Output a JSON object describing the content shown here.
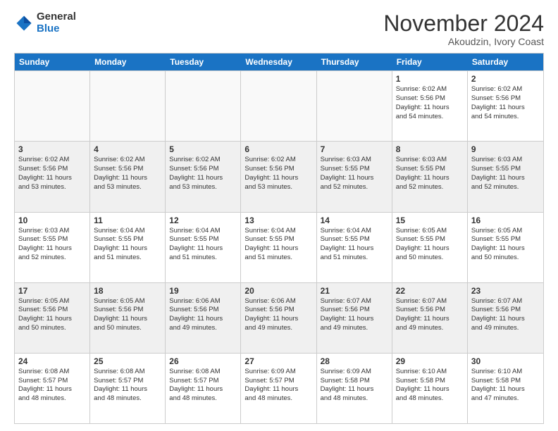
{
  "logo": {
    "general": "General",
    "blue": "Blue"
  },
  "title": "November 2024",
  "location": "Akoudzin, Ivory Coast",
  "header_days": [
    "Sunday",
    "Monday",
    "Tuesday",
    "Wednesday",
    "Thursday",
    "Friday",
    "Saturday"
  ],
  "rows": [
    [
      {
        "day": "",
        "info": "",
        "empty": true
      },
      {
        "day": "",
        "info": "",
        "empty": true
      },
      {
        "day": "",
        "info": "",
        "empty": true
      },
      {
        "day": "",
        "info": "",
        "empty": true
      },
      {
        "day": "",
        "info": "",
        "empty": true
      },
      {
        "day": "1",
        "info": "Sunrise: 6:02 AM\nSunset: 5:56 PM\nDaylight: 11 hours\nand 54 minutes."
      },
      {
        "day": "2",
        "info": "Sunrise: 6:02 AM\nSunset: 5:56 PM\nDaylight: 11 hours\nand 54 minutes."
      }
    ],
    [
      {
        "day": "3",
        "info": "Sunrise: 6:02 AM\nSunset: 5:56 PM\nDaylight: 11 hours\nand 53 minutes."
      },
      {
        "day": "4",
        "info": "Sunrise: 6:02 AM\nSunset: 5:56 PM\nDaylight: 11 hours\nand 53 minutes."
      },
      {
        "day": "5",
        "info": "Sunrise: 6:02 AM\nSunset: 5:56 PM\nDaylight: 11 hours\nand 53 minutes."
      },
      {
        "day": "6",
        "info": "Sunrise: 6:02 AM\nSunset: 5:56 PM\nDaylight: 11 hours\nand 53 minutes."
      },
      {
        "day": "7",
        "info": "Sunrise: 6:03 AM\nSunset: 5:55 PM\nDaylight: 11 hours\nand 52 minutes."
      },
      {
        "day": "8",
        "info": "Sunrise: 6:03 AM\nSunset: 5:55 PM\nDaylight: 11 hours\nand 52 minutes."
      },
      {
        "day": "9",
        "info": "Sunrise: 6:03 AM\nSunset: 5:55 PM\nDaylight: 11 hours\nand 52 minutes."
      }
    ],
    [
      {
        "day": "10",
        "info": "Sunrise: 6:03 AM\nSunset: 5:55 PM\nDaylight: 11 hours\nand 52 minutes."
      },
      {
        "day": "11",
        "info": "Sunrise: 6:04 AM\nSunset: 5:55 PM\nDaylight: 11 hours\nand 51 minutes."
      },
      {
        "day": "12",
        "info": "Sunrise: 6:04 AM\nSunset: 5:55 PM\nDaylight: 11 hours\nand 51 minutes."
      },
      {
        "day": "13",
        "info": "Sunrise: 6:04 AM\nSunset: 5:55 PM\nDaylight: 11 hours\nand 51 minutes."
      },
      {
        "day": "14",
        "info": "Sunrise: 6:04 AM\nSunset: 5:55 PM\nDaylight: 11 hours\nand 51 minutes."
      },
      {
        "day": "15",
        "info": "Sunrise: 6:05 AM\nSunset: 5:55 PM\nDaylight: 11 hours\nand 50 minutes."
      },
      {
        "day": "16",
        "info": "Sunrise: 6:05 AM\nSunset: 5:55 PM\nDaylight: 11 hours\nand 50 minutes."
      }
    ],
    [
      {
        "day": "17",
        "info": "Sunrise: 6:05 AM\nSunset: 5:56 PM\nDaylight: 11 hours\nand 50 minutes."
      },
      {
        "day": "18",
        "info": "Sunrise: 6:05 AM\nSunset: 5:56 PM\nDaylight: 11 hours\nand 50 minutes."
      },
      {
        "day": "19",
        "info": "Sunrise: 6:06 AM\nSunset: 5:56 PM\nDaylight: 11 hours\nand 49 minutes."
      },
      {
        "day": "20",
        "info": "Sunrise: 6:06 AM\nSunset: 5:56 PM\nDaylight: 11 hours\nand 49 minutes."
      },
      {
        "day": "21",
        "info": "Sunrise: 6:07 AM\nSunset: 5:56 PM\nDaylight: 11 hours\nand 49 minutes."
      },
      {
        "day": "22",
        "info": "Sunrise: 6:07 AM\nSunset: 5:56 PM\nDaylight: 11 hours\nand 49 minutes."
      },
      {
        "day": "23",
        "info": "Sunrise: 6:07 AM\nSunset: 5:56 PM\nDaylight: 11 hours\nand 49 minutes."
      }
    ],
    [
      {
        "day": "24",
        "info": "Sunrise: 6:08 AM\nSunset: 5:57 PM\nDaylight: 11 hours\nand 48 minutes."
      },
      {
        "day": "25",
        "info": "Sunrise: 6:08 AM\nSunset: 5:57 PM\nDaylight: 11 hours\nand 48 minutes."
      },
      {
        "day": "26",
        "info": "Sunrise: 6:08 AM\nSunset: 5:57 PM\nDaylight: 11 hours\nand 48 minutes."
      },
      {
        "day": "27",
        "info": "Sunrise: 6:09 AM\nSunset: 5:57 PM\nDaylight: 11 hours\nand 48 minutes."
      },
      {
        "day": "28",
        "info": "Sunrise: 6:09 AM\nSunset: 5:58 PM\nDaylight: 11 hours\nand 48 minutes."
      },
      {
        "day": "29",
        "info": "Sunrise: 6:10 AM\nSunset: 5:58 PM\nDaylight: 11 hours\nand 48 minutes."
      },
      {
        "day": "30",
        "info": "Sunrise: 6:10 AM\nSunset: 5:58 PM\nDaylight: 11 hours\nand 47 minutes."
      }
    ]
  ]
}
